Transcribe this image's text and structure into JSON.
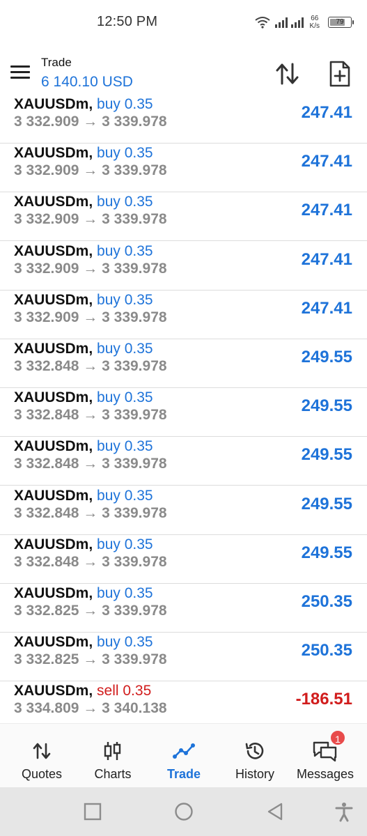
{
  "status_bar": {
    "time": "12:50 PM",
    "net_speed_value": "66",
    "net_speed_unit": "K/s",
    "battery_level": "79",
    "icons": [
      "wifi-icon",
      "signal-icon",
      "battery-icon"
    ]
  },
  "header": {
    "title": "Trade",
    "balance": "6 140.10 USD",
    "icons": [
      "menu-icon",
      "sort-icon",
      "new-order-icon"
    ]
  },
  "positions": [
    {
      "symbol": "XAUUSDm,",
      "direction": "buy 0.35",
      "open_price": "3 332.909",
      "arrow": "→",
      "current_price": "3 339.978",
      "profit": "247.41"
    },
    {
      "symbol": "XAUUSDm,",
      "direction": "buy 0.35",
      "open_price": "3 332.909",
      "arrow": "→",
      "current_price": "3 339.978",
      "profit": "247.41"
    },
    {
      "symbol": "XAUUSDm,",
      "direction": "buy 0.35",
      "open_price": "3 332.909",
      "arrow": "→",
      "current_price": "3 339.978",
      "profit": "247.41"
    },
    {
      "symbol": "XAUUSDm,",
      "direction": "buy 0.35",
      "open_price": "3 332.909",
      "arrow": "→",
      "current_price": "3 339.978",
      "profit": "247.41"
    },
    {
      "symbol": "XAUUSDm,",
      "direction": "buy 0.35",
      "open_price": "3 332.909",
      "arrow": "→",
      "current_price": "3 339.978",
      "profit": "247.41"
    },
    {
      "symbol": "XAUUSDm,",
      "direction": "buy 0.35",
      "open_price": "3 332.848",
      "arrow": "→",
      "current_price": "3 339.978",
      "profit": "249.55"
    },
    {
      "symbol": "XAUUSDm,",
      "direction": "buy 0.35",
      "open_price": "3 332.848",
      "arrow": "→",
      "current_price": "3 339.978",
      "profit": "249.55"
    },
    {
      "symbol": "XAUUSDm,",
      "direction": "buy 0.35",
      "open_price": "3 332.848",
      "arrow": "→",
      "current_price": "3 339.978",
      "profit": "249.55"
    },
    {
      "symbol": "XAUUSDm,",
      "direction": "buy 0.35",
      "open_price": "3 332.848",
      "arrow": "→",
      "current_price": "3 339.978",
      "profit": "249.55"
    },
    {
      "symbol": "XAUUSDm,",
      "direction": "buy 0.35",
      "open_price": "3 332.848",
      "arrow": "→",
      "current_price": "3 339.978",
      "profit": "249.55"
    },
    {
      "symbol": "XAUUSDm,",
      "direction": "buy 0.35",
      "open_price": "3 332.825",
      "arrow": "→",
      "current_price": "3 339.978",
      "profit": "250.35"
    },
    {
      "symbol": "XAUUSDm,",
      "direction": "buy 0.35",
      "open_price": "3 332.825",
      "arrow": "→",
      "current_price": "3 339.978",
      "profit": "250.35"
    },
    {
      "symbol": "XAUUSDm,",
      "direction": "sell 0.35",
      "open_price": "3 334.809",
      "arrow": "→",
      "current_price": "3 340.138",
      "profit": "-186.51"
    }
  ],
  "bottom_nav": {
    "quotes": "Quotes",
    "charts": "Charts",
    "trade": "Trade",
    "history": "History",
    "messages": "Messages",
    "messages_badge": "1",
    "active": "Trade"
  },
  "colors": {
    "accent": "#1e73d9",
    "loss": "#d11c1c",
    "secondary_text": "#8a8a8a",
    "badge": "#e84b4b"
  },
  "system_nav": {
    "icons": [
      "recents-icon",
      "home-icon",
      "back-icon",
      "accessibility-icon"
    ]
  }
}
